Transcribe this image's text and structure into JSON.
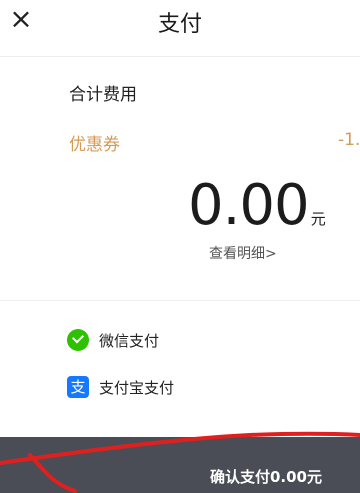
{
  "header": {
    "close_icon": "×",
    "title": "支付"
  },
  "summary": {
    "total_label": "合计费用",
    "coupon_label": "优惠券",
    "coupon_amount": "-1.",
    "amount": "0.00",
    "currency": "元",
    "detail_link": "查看明细>"
  },
  "payment_methods": [
    {
      "icon": "wechat-icon",
      "label": "微信支付"
    },
    {
      "icon": "alipay-icon",
      "icon_text": "支",
      "label": "支付宝支付"
    }
  ],
  "footer": {
    "confirm_label": "确认支付0.00元"
  },
  "colors": {
    "accent_coupon": "#d69a57",
    "footer_bg": "#4a4d55",
    "annotation": "#e0201e"
  }
}
